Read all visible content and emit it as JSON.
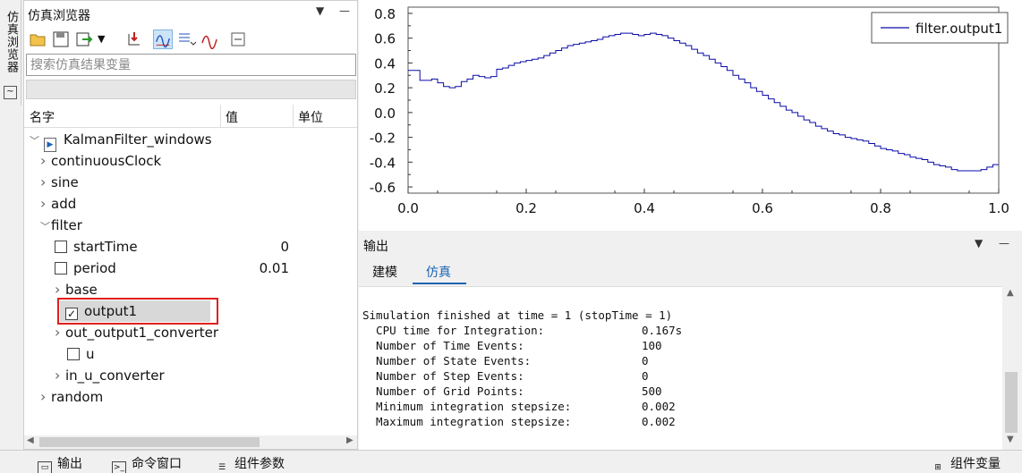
{
  "side_tab": {
    "label": "仿真浏览器"
  },
  "browser": {
    "title": "仿真浏览器",
    "search_placeholder": "搜索仿真结果变量",
    "columns": [
      "名字",
      "值",
      "单位"
    ],
    "tree": [
      {
        "label": "KalmanFilter_windows",
        "level": 0,
        "expanded": true,
        "has_model_icon": true
      },
      {
        "label": "continuousClock",
        "level": 1,
        "expanded": false
      },
      {
        "label": "sine",
        "level": 1,
        "expanded": false
      },
      {
        "label": "add",
        "level": 1,
        "expanded": false
      },
      {
        "label": "filter",
        "level": 1,
        "expanded": true
      },
      {
        "label": "startTime",
        "level": 2,
        "checkbox": true,
        "checked": false,
        "value": "0"
      },
      {
        "label": "period",
        "level": 2,
        "checkbox": true,
        "checked": false,
        "value": "0.01"
      },
      {
        "label": "base",
        "level": 2,
        "expanded": false
      },
      {
        "label": "output1",
        "level": 2,
        "checkbox": true,
        "checked": true,
        "selected": true
      },
      {
        "label": "out_output1_converter",
        "level": 2,
        "expanded": false
      },
      {
        "label": "u",
        "level": 3,
        "checkbox": true,
        "checked": false
      },
      {
        "label": "in_u_converter",
        "level": 2,
        "expanded": false
      },
      {
        "label": "random",
        "level": 1,
        "expanded": false
      }
    ]
  },
  "chart_data": {
    "type": "line",
    "legend": "top-right",
    "series": [
      {
        "name": "filter.output1",
        "color": "#0a0aa8"
      }
    ],
    "x_ticks": [
      "0.0",
      "0.2",
      "0.4",
      "0.6",
      "0.8",
      "1.0"
    ],
    "y_ticks": [
      "0.8",
      "0.6",
      "0.4",
      "0.2",
      "0.0",
      "-0.2",
      "-0.4",
      "-0.6"
    ],
    "xlim": [
      0,
      1
    ],
    "ylim": [
      -0.65,
      0.85
    ],
    "grid": false,
    "points": [
      [
        0,
        0.34
      ],
      [
        0.01,
        0.34
      ],
      [
        0.02,
        0.34
      ],
      [
        0.02,
        0.26
      ],
      [
        0.03,
        0.26
      ],
      [
        0.04,
        0.27
      ],
      [
        0.05,
        0.24
      ],
      [
        0.06,
        0.21
      ],
      [
        0.07,
        0.2
      ],
      [
        0.08,
        0.21
      ],
      [
        0.09,
        0.25
      ],
      [
        0.1,
        0.27
      ],
      [
        0.11,
        0.3
      ],
      [
        0.12,
        0.29
      ],
      [
        0.13,
        0.28
      ],
      [
        0.14,
        0.29
      ],
      [
        0.15,
        0.35
      ],
      [
        0.16,
        0.36
      ],
      [
        0.17,
        0.38
      ],
      [
        0.18,
        0.4
      ],
      [
        0.19,
        0.41
      ],
      [
        0.2,
        0.42
      ],
      [
        0.21,
        0.43
      ],
      [
        0.22,
        0.44
      ],
      [
        0.23,
        0.46
      ],
      [
        0.24,
        0.48
      ],
      [
        0.25,
        0.5
      ],
      [
        0.26,
        0.52
      ],
      [
        0.27,
        0.54
      ],
      [
        0.28,
        0.55
      ],
      [
        0.29,
        0.56
      ],
      [
        0.3,
        0.57
      ],
      [
        0.31,
        0.58
      ],
      [
        0.32,
        0.59
      ],
      [
        0.33,
        0.61
      ],
      [
        0.34,
        0.62
      ],
      [
        0.35,
        0.63
      ],
      [
        0.36,
        0.64
      ],
      [
        0.37,
        0.64
      ],
      [
        0.38,
        0.63
      ],
      [
        0.39,
        0.62
      ],
      [
        0.4,
        0.63
      ],
      [
        0.41,
        0.64
      ],
      [
        0.42,
        0.63
      ],
      [
        0.43,
        0.62
      ],
      [
        0.44,
        0.6
      ],
      [
        0.45,
        0.58
      ],
      [
        0.46,
        0.56
      ],
      [
        0.47,
        0.54
      ],
      [
        0.48,
        0.51
      ],
      [
        0.49,
        0.48
      ],
      [
        0.5,
        0.46
      ],
      [
        0.51,
        0.43
      ],
      [
        0.52,
        0.4
      ],
      [
        0.53,
        0.37
      ],
      [
        0.54,
        0.34
      ],
      [
        0.55,
        0.3
      ],
      [
        0.56,
        0.27
      ],
      [
        0.57,
        0.24
      ],
      [
        0.58,
        0.2
      ],
      [
        0.59,
        0.17
      ],
      [
        0.6,
        0.14
      ],
      [
        0.61,
        0.11
      ],
      [
        0.62,
        0.08
      ],
      [
        0.63,
        0.05
      ],
      [
        0.64,
        0.02
      ],
      [
        0.65,
        0.0
      ],
      [
        0.66,
        -0.03
      ],
      [
        0.67,
        -0.06
      ],
      [
        0.68,
        -0.08
      ],
      [
        0.69,
        -0.11
      ],
      [
        0.7,
        -0.13
      ],
      [
        0.71,
        -0.15
      ],
      [
        0.72,
        -0.17
      ],
      [
        0.73,
        -0.18
      ],
      [
        0.74,
        -0.2
      ],
      [
        0.75,
        -0.21
      ],
      [
        0.76,
        -0.22
      ],
      [
        0.77,
        -0.23
      ],
      [
        0.78,
        -0.25
      ],
      [
        0.79,
        -0.27
      ],
      [
        0.8,
        -0.29
      ],
      [
        0.81,
        -0.3
      ],
      [
        0.82,
        -0.31
      ],
      [
        0.83,
        -0.33
      ],
      [
        0.84,
        -0.34
      ],
      [
        0.85,
        -0.36
      ],
      [
        0.86,
        -0.37
      ],
      [
        0.87,
        -0.38
      ],
      [
        0.88,
        -0.4
      ],
      [
        0.89,
        -0.42
      ],
      [
        0.9,
        -0.43
      ],
      [
        0.91,
        -0.44
      ],
      [
        0.92,
        -0.46
      ],
      [
        0.93,
        -0.47
      ],
      [
        0.94,
        -0.47
      ],
      [
        0.95,
        -0.47
      ],
      [
        0.96,
        -0.47
      ],
      [
        0.97,
        -0.46
      ],
      [
        0.98,
        -0.44
      ],
      [
        0.99,
        -0.42
      ],
      [
        1.0,
        -0.42
      ]
    ]
  },
  "output": {
    "title": "输出",
    "tabs": [
      "建模",
      "仿真"
    ],
    "active_tab": "仿真",
    "lines": [
      {
        "text": "Simulation finished at time = 1 (stopTime = 1)",
        "value": ""
      },
      {
        "text": "  CPU time for Integration:",
        "value": "0.167s"
      },
      {
        "text": "  Number of Time Events:",
        "value": "100"
      },
      {
        "text": "  Number of State Events:",
        "value": "0"
      },
      {
        "text": "  Number of Step Events:",
        "value": "0"
      },
      {
        "text": "  Number of Grid Points:",
        "value": "500"
      },
      {
        "text": "  Minimum integration stepsize:",
        "value": "0.002"
      },
      {
        "text": "  Maximum integration stepsize:",
        "value": "0.002"
      }
    ]
  },
  "bottom": {
    "output": "输出",
    "command": "命令窗口",
    "params": "组件参数",
    "variables": "组件变量"
  }
}
